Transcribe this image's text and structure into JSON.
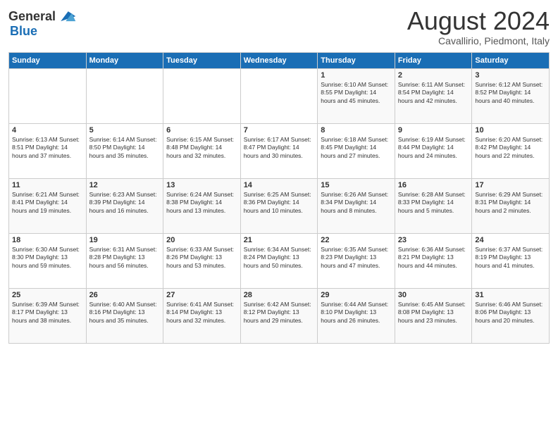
{
  "header": {
    "logo_line1": "General",
    "logo_line2": "Blue",
    "month_title": "August 2024",
    "location": "Cavallirio, Piedmont, Italy"
  },
  "weekdays": [
    "Sunday",
    "Monday",
    "Tuesday",
    "Wednesday",
    "Thursday",
    "Friday",
    "Saturday"
  ],
  "weeks": [
    [
      {
        "day": "",
        "info": ""
      },
      {
        "day": "",
        "info": ""
      },
      {
        "day": "",
        "info": ""
      },
      {
        "day": "",
        "info": ""
      },
      {
        "day": "1",
        "info": "Sunrise: 6:10 AM\nSunset: 8:55 PM\nDaylight: 14 hours and 45 minutes."
      },
      {
        "day": "2",
        "info": "Sunrise: 6:11 AM\nSunset: 8:54 PM\nDaylight: 14 hours and 42 minutes."
      },
      {
        "day": "3",
        "info": "Sunrise: 6:12 AM\nSunset: 8:52 PM\nDaylight: 14 hours and 40 minutes."
      }
    ],
    [
      {
        "day": "4",
        "info": "Sunrise: 6:13 AM\nSunset: 8:51 PM\nDaylight: 14 hours and 37 minutes."
      },
      {
        "day": "5",
        "info": "Sunrise: 6:14 AM\nSunset: 8:50 PM\nDaylight: 14 hours and 35 minutes."
      },
      {
        "day": "6",
        "info": "Sunrise: 6:15 AM\nSunset: 8:48 PM\nDaylight: 14 hours and 32 minutes."
      },
      {
        "day": "7",
        "info": "Sunrise: 6:17 AM\nSunset: 8:47 PM\nDaylight: 14 hours and 30 minutes."
      },
      {
        "day": "8",
        "info": "Sunrise: 6:18 AM\nSunset: 8:45 PM\nDaylight: 14 hours and 27 minutes."
      },
      {
        "day": "9",
        "info": "Sunrise: 6:19 AM\nSunset: 8:44 PM\nDaylight: 14 hours and 24 minutes."
      },
      {
        "day": "10",
        "info": "Sunrise: 6:20 AM\nSunset: 8:42 PM\nDaylight: 14 hours and 22 minutes."
      }
    ],
    [
      {
        "day": "11",
        "info": "Sunrise: 6:21 AM\nSunset: 8:41 PM\nDaylight: 14 hours and 19 minutes."
      },
      {
        "day": "12",
        "info": "Sunrise: 6:23 AM\nSunset: 8:39 PM\nDaylight: 14 hours and 16 minutes."
      },
      {
        "day": "13",
        "info": "Sunrise: 6:24 AM\nSunset: 8:38 PM\nDaylight: 14 hours and 13 minutes."
      },
      {
        "day": "14",
        "info": "Sunrise: 6:25 AM\nSunset: 8:36 PM\nDaylight: 14 hours and 10 minutes."
      },
      {
        "day": "15",
        "info": "Sunrise: 6:26 AM\nSunset: 8:34 PM\nDaylight: 14 hours and 8 minutes."
      },
      {
        "day": "16",
        "info": "Sunrise: 6:28 AM\nSunset: 8:33 PM\nDaylight: 14 hours and 5 minutes."
      },
      {
        "day": "17",
        "info": "Sunrise: 6:29 AM\nSunset: 8:31 PM\nDaylight: 14 hours and 2 minutes."
      }
    ],
    [
      {
        "day": "18",
        "info": "Sunrise: 6:30 AM\nSunset: 8:30 PM\nDaylight: 13 hours and 59 minutes."
      },
      {
        "day": "19",
        "info": "Sunrise: 6:31 AM\nSunset: 8:28 PM\nDaylight: 13 hours and 56 minutes."
      },
      {
        "day": "20",
        "info": "Sunrise: 6:33 AM\nSunset: 8:26 PM\nDaylight: 13 hours and 53 minutes."
      },
      {
        "day": "21",
        "info": "Sunrise: 6:34 AM\nSunset: 8:24 PM\nDaylight: 13 hours and 50 minutes."
      },
      {
        "day": "22",
        "info": "Sunrise: 6:35 AM\nSunset: 8:23 PM\nDaylight: 13 hours and 47 minutes."
      },
      {
        "day": "23",
        "info": "Sunrise: 6:36 AM\nSunset: 8:21 PM\nDaylight: 13 hours and 44 minutes."
      },
      {
        "day": "24",
        "info": "Sunrise: 6:37 AM\nSunset: 8:19 PM\nDaylight: 13 hours and 41 minutes."
      }
    ],
    [
      {
        "day": "25",
        "info": "Sunrise: 6:39 AM\nSunset: 8:17 PM\nDaylight: 13 hours and 38 minutes."
      },
      {
        "day": "26",
        "info": "Sunrise: 6:40 AM\nSunset: 8:16 PM\nDaylight: 13 hours and 35 minutes."
      },
      {
        "day": "27",
        "info": "Sunrise: 6:41 AM\nSunset: 8:14 PM\nDaylight: 13 hours and 32 minutes."
      },
      {
        "day": "28",
        "info": "Sunrise: 6:42 AM\nSunset: 8:12 PM\nDaylight: 13 hours and 29 minutes."
      },
      {
        "day": "29",
        "info": "Sunrise: 6:44 AM\nSunset: 8:10 PM\nDaylight: 13 hours and 26 minutes."
      },
      {
        "day": "30",
        "info": "Sunrise: 6:45 AM\nSunset: 8:08 PM\nDaylight: 13 hours and 23 minutes."
      },
      {
        "day": "31",
        "info": "Sunrise: 6:46 AM\nSunset: 8:06 PM\nDaylight: 13 hours and 20 minutes."
      }
    ]
  ]
}
